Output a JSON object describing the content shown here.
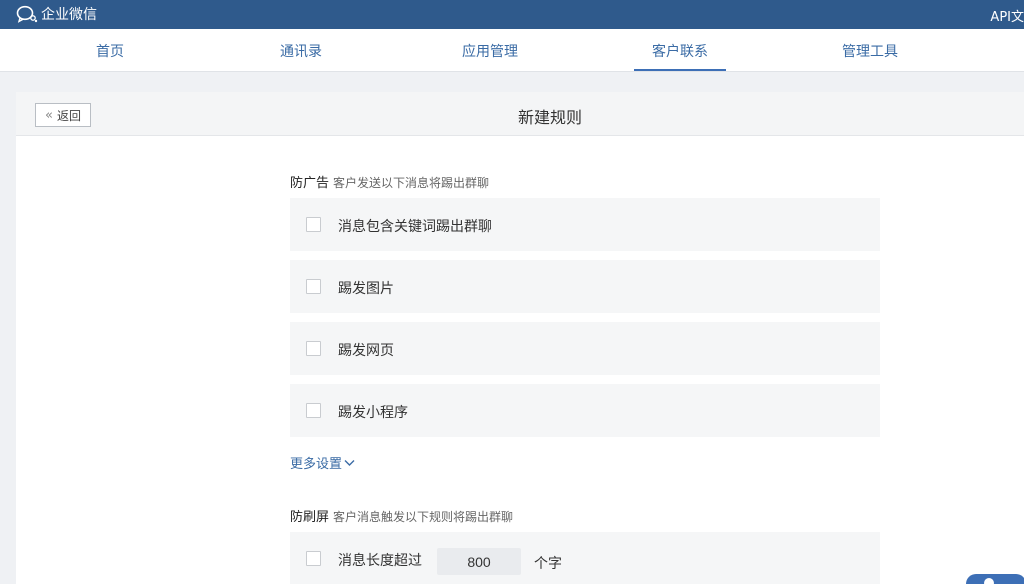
{
  "app": {
    "brand": "企业微信",
    "api_link": "API文"
  },
  "nav": {
    "items": [
      {
        "label": "首页"
      },
      {
        "label": "通讯录"
      },
      {
        "label": "应用管理"
      },
      {
        "label": "客户联系"
      },
      {
        "label": "管理工具"
      }
    ],
    "active": "客户联系"
  },
  "header": {
    "back_label": "返回",
    "title": "新建规则"
  },
  "anti_ads": {
    "title": "防广告",
    "subtitle": "客户发送以下消息将踢出群聊",
    "options": [
      {
        "label": "消息包含关键词踢出群聊",
        "checked": false
      },
      {
        "label": "踢发图片",
        "checked": false
      },
      {
        "label": "踢发网页",
        "checked": false
      },
      {
        "label": "踢发小程序",
        "checked": false
      }
    ],
    "more_settings": "更多设置"
  },
  "anti_spam": {
    "title": "防刷屏",
    "subtitle": "客户消息触发以下规则将踢出群聊",
    "length_rule": {
      "label": "消息长度超过",
      "value": "800",
      "unit": "个字",
      "checked": false
    }
  },
  "colors": {
    "topbar": "#2f5a8c",
    "link": "#3a6ba5",
    "active_underline": "#3d6fb6",
    "row_bg": "#f5f6f7"
  },
  "icons": [
    "chat-bubble-logo-icon",
    "double-chevron-left-icon",
    "chevron-down-icon"
  ]
}
